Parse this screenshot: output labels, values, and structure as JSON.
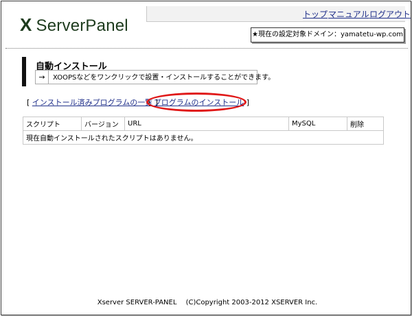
{
  "logo": {
    "mark": "X",
    "text": "ServerPanel"
  },
  "nav": {
    "top": "トップ",
    "manual": "マニュアル",
    "logout": "ログアウト"
  },
  "domain": {
    "label": "★現在の設定対象ドメイン：yamatetu-wp.com"
  },
  "page": {
    "title": "自動インストール",
    "arrow": "→",
    "description": "XOOPSなどをワンクリックで設置・インストールすることができます。"
  },
  "links": {
    "bracket_open": "[ ",
    "installed_list": "インストール済みプログラムの一覧",
    "bracket_close": " ]",
    "install_bracket_open": "[ ",
    "install_program": "プログラムのインストール",
    "install_bracket_close": " ]"
  },
  "table": {
    "headers": [
      "スクリプト",
      "バージョン",
      "URL",
      "MySQL",
      "削除"
    ],
    "empty_message": "現在自動インストールされたスクリプトはありません。"
  },
  "footer": {
    "text": "Xserver SERVER-PANEL　 (C)Copyright 2003-2012 XSERVER Inc."
  },
  "colors": {
    "link": "#1f2f8a",
    "highlight_ellipse": "#e01818",
    "logo": "#1d3b1d"
  }
}
